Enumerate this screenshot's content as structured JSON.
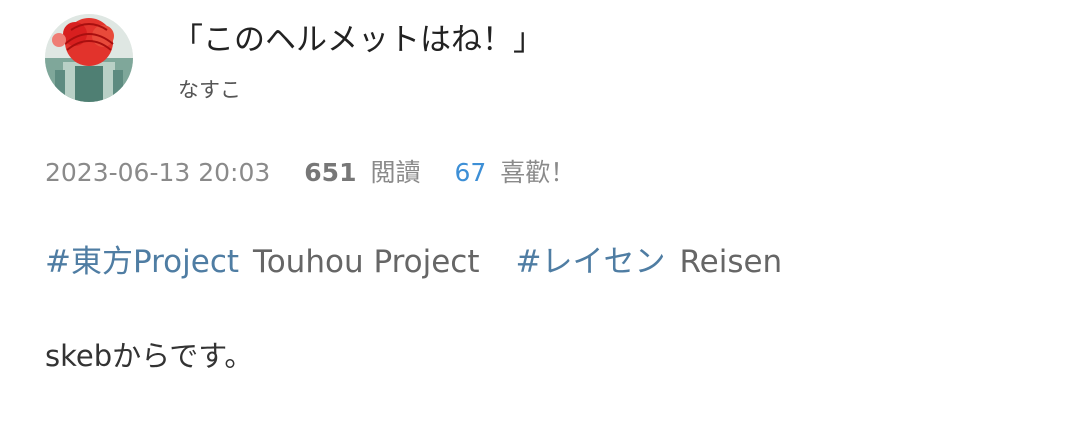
{
  "work": {
    "title": "「このヘルメットはね！」",
    "author": "なすこ",
    "date": "2023-06-13 20:03",
    "views_count": "651",
    "views_label": "閲讀",
    "likes_count": "67",
    "likes_label": "喜歡！",
    "description": "skebからです。"
  },
  "tags": [
    {
      "name": "#東方Project",
      "translation": "Touhou Project"
    },
    {
      "name": "#レイセン",
      "translation": "Reisen"
    }
  ],
  "colors": {
    "tag_accent": "#4f7da3",
    "likes_accent": "#3d8fd6"
  },
  "icons": {
    "avatar": "author-avatar"
  }
}
